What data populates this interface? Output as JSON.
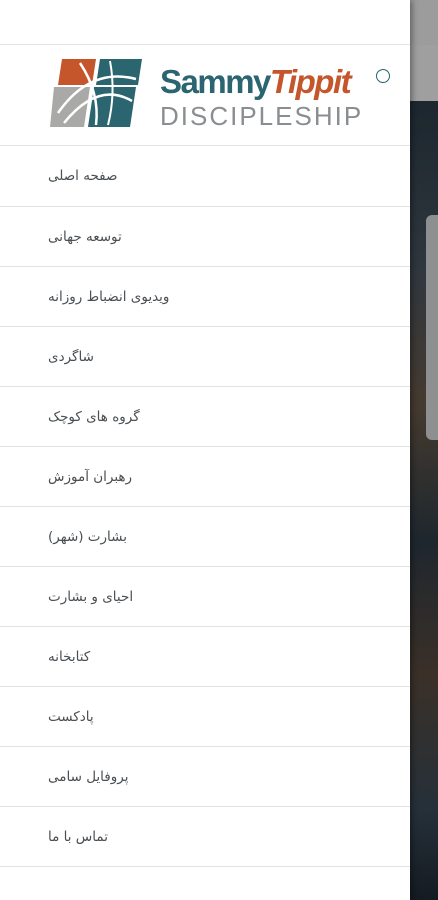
{
  "brand": {
    "name_part1": "Sammy",
    "name_part2": "Tippit",
    "subtitle": "DISCIPLESHIP",
    "teal_color": "#2a6570",
    "orange_color": "#c5552b",
    "gray_color": "#8a8e91"
  },
  "menu": {
    "items": [
      {
        "label": "صفحه اصلی"
      },
      {
        "label": "توسعه جهانی"
      },
      {
        "label": "ویدیوی انضباط روزانه"
      },
      {
        "label": "شاگردی"
      },
      {
        "label": "گروه های کوچک"
      },
      {
        "label": "رهبران آموزش"
      },
      {
        "label": "بشارت (شهر)"
      },
      {
        "label": "احیای و بشارت"
      },
      {
        "label": "کتابخانه"
      },
      {
        "label": "پادکست"
      },
      {
        "label": "پروفایل سامی"
      },
      {
        "label": "تماس با ما"
      }
    ]
  }
}
